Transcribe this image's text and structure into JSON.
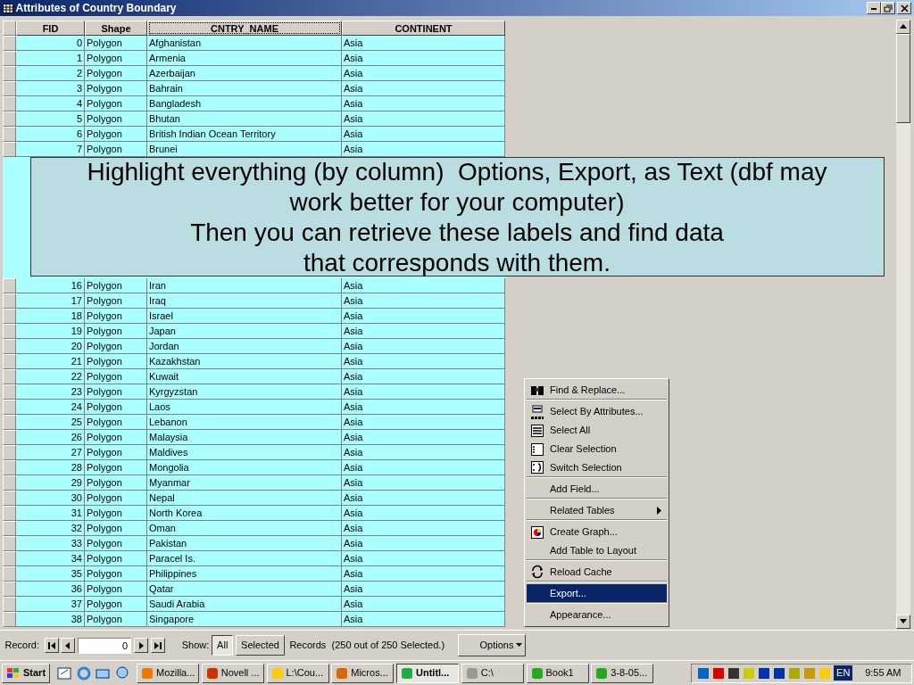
{
  "window": {
    "title": "Attributes of Country Boundary"
  },
  "table": {
    "columns": [
      {
        "label": "FID",
        "focused": false
      },
      {
        "label": "Shape",
        "focused": false
      },
      {
        "label": "CNTRY_NAME",
        "focused": true
      },
      {
        "label": "CONTINENT",
        "focused": false
      }
    ],
    "rows_top": [
      {
        "fid": "0",
        "shape": "Polygon",
        "name": "Afghanistan",
        "continent": "Asia"
      },
      {
        "fid": "1",
        "shape": "Polygon",
        "name": "Armenia",
        "continent": "Asia"
      },
      {
        "fid": "2",
        "shape": "Polygon",
        "name": "Azerbaijan",
        "continent": "Asia"
      },
      {
        "fid": "3",
        "shape": "Polygon",
        "name": "Bahrain",
        "continent": "Asia"
      },
      {
        "fid": "4",
        "shape": "Polygon",
        "name": "Bangladesh",
        "continent": "Asia"
      },
      {
        "fid": "5",
        "shape": "Polygon",
        "name": "Bhutan",
        "continent": "Asia"
      },
      {
        "fid": "6",
        "shape": "Polygon",
        "name": "British Indian Ocean Territory",
        "continent": "Asia"
      },
      {
        "fid": "7",
        "shape": "Polygon",
        "name": "Brunei",
        "continent": "Asia"
      }
    ],
    "rows_bottom": [
      {
        "fid": "16",
        "shape": "Polygon",
        "name": "Iran",
        "continent": "Asia"
      },
      {
        "fid": "17",
        "shape": "Polygon",
        "name": "Iraq",
        "continent": "Asia"
      },
      {
        "fid": "18",
        "shape": "Polygon",
        "name": "Israel",
        "continent": "Asia"
      },
      {
        "fid": "19",
        "shape": "Polygon",
        "name": "Japan",
        "continent": "Asia"
      },
      {
        "fid": "20",
        "shape": "Polygon",
        "name": "Jordan",
        "continent": "Asia"
      },
      {
        "fid": "21",
        "shape": "Polygon",
        "name": "Kazakhstan",
        "continent": "Asia"
      },
      {
        "fid": "22",
        "shape": "Polygon",
        "name": "Kuwait",
        "continent": "Asia"
      },
      {
        "fid": "23",
        "shape": "Polygon",
        "name": "Kyrgyzstan",
        "continent": "Asia"
      },
      {
        "fid": "24",
        "shape": "Polygon",
        "name": "Laos",
        "continent": "Asia"
      },
      {
        "fid": "25",
        "shape": "Polygon",
        "name": "Lebanon",
        "continent": "Asia"
      },
      {
        "fid": "26",
        "shape": "Polygon",
        "name": "Malaysia",
        "continent": "Asia"
      },
      {
        "fid": "27",
        "shape": "Polygon",
        "name": "Maldives",
        "continent": "Asia"
      },
      {
        "fid": "28",
        "shape": "Polygon",
        "name": "Mongolia",
        "continent": "Asia"
      },
      {
        "fid": "29",
        "shape": "Polygon",
        "name": "Myanmar",
        "continent": "Asia"
      },
      {
        "fid": "30",
        "shape": "Polygon",
        "name": "Nepal",
        "continent": "Asia"
      },
      {
        "fid": "31",
        "shape": "Polygon",
        "name": "North Korea",
        "continent": "Asia"
      },
      {
        "fid": "32",
        "shape": "Polygon",
        "name": "Oman",
        "continent": "Asia"
      },
      {
        "fid": "33",
        "shape": "Polygon",
        "name": "Pakistan",
        "continent": "Asia"
      },
      {
        "fid": "34",
        "shape": "Polygon",
        "name": "Paracel Is.",
        "continent": "Asia"
      },
      {
        "fid": "35",
        "shape": "Polygon",
        "name": "Philippines",
        "continent": "Asia"
      },
      {
        "fid": "36",
        "shape": "Polygon",
        "name": "Qatar",
        "continent": "Asia"
      },
      {
        "fid": "37",
        "shape": "Polygon",
        "name": "Saudi Arabia",
        "continent": "Asia"
      },
      {
        "fid": "38",
        "shape": "Polygon",
        "name": "Singapore",
        "continent": "Asia"
      }
    ]
  },
  "annotation": {
    "lines": [
      "Highlight everything (by column)  Options, Export, as Text (dbf may",
      "work better for your computer)",
      "Then you can retrieve these labels and find data",
      "that corresponds with them."
    ]
  },
  "context_menu": [
    {
      "label": "Find & Replace...",
      "selected": false,
      "submenu": false,
      "separator_after": true
    },
    {
      "label": "Select By Attributes...",
      "selected": false,
      "submenu": false,
      "separator_after": false
    },
    {
      "label": "Select All",
      "selected": false,
      "submenu": false,
      "separator_after": false
    },
    {
      "label": "Clear Selection",
      "selected": false,
      "submenu": false,
      "separator_after": false
    },
    {
      "label": "Switch Selection",
      "selected": false,
      "submenu": false,
      "separator_after": true
    },
    {
      "label": "Add Field...",
      "selected": false,
      "submenu": false,
      "separator_after": true
    },
    {
      "label": "Related Tables",
      "selected": false,
      "submenu": true,
      "separator_after": true
    },
    {
      "label": "Create Graph...",
      "selected": false,
      "submenu": false,
      "separator_after": false
    },
    {
      "label": "Add Table to Layout",
      "selected": false,
      "submenu": false,
      "separator_after": true
    },
    {
      "label": "Reload Cache",
      "selected": false,
      "submenu": false,
      "separator_after": true
    },
    {
      "label": "Export...",
      "selected": true,
      "submenu": false,
      "separator_after": true
    },
    {
      "label": "Appearance...",
      "selected": false,
      "submenu": false,
      "separator_after": false
    }
  ],
  "record_bar": {
    "record_label": "Record:",
    "record_value": "0",
    "show_label": "Show:",
    "show_options": [
      {
        "label": "All",
        "selected": true
      },
      {
        "label": "Selected",
        "selected": false
      }
    ],
    "summary": "Records  (250 out of 250 Selected.)",
    "options_button": "Options"
  },
  "taskbar": {
    "start": "Start",
    "tasks": [
      {
        "label": "Mozilla...",
        "selected": false
      },
      {
        "label": "Novell ...",
        "selected": false
      },
      {
        "label": "L:\\Cou...",
        "selected": false
      },
      {
        "label": "Micros...",
        "selected": false
      },
      {
        "label": "Untitl...",
        "selected": true
      },
      {
        "label": "C:\\",
        "selected": false
      },
      {
        "label": "Book1",
        "selected": false
      },
      {
        "label": "3-8-05...",
        "selected": false
      }
    ],
    "language": "EN",
    "clock": "9:55 AM"
  }
}
